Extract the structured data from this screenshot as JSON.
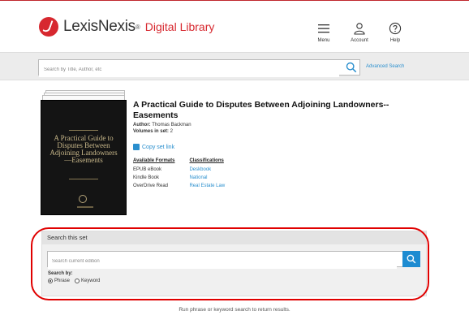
{
  "header": {
    "brand": "LexisNexis",
    "brand_mark": "®",
    "product": "Digital Library",
    "nav": [
      {
        "label": "Menu",
        "icon": "menu-icon"
      },
      {
        "label": "Account",
        "icon": "account-icon"
      },
      {
        "label": "Help",
        "icon": "help-icon"
      }
    ]
  },
  "search": {
    "placeholder": "Search by Title, Author, etc",
    "advanced_label": "Advanced Search"
  },
  "book": {
    "title": "A Practical Guide to Disputes Between Adjoining Landowners--Easements",
    "author_label": "Author:",
    "author": "Thomas Backman",
    "volumes_label": "Volumes in set:",
    "volumes": "2",
    "copy_link": "Copy set link",
    "cover_title": "A Practical Guide to Disputes Between Adjoining Landowners —Easements",
    "formats_header": "Available Formats",
    "formats": [
      "EPUB eBook",
      "Kindle Book",
      "OverDrive Read"
    ],
    "classifications_header": "Classifications",
    "classifications": [
      "Deskbook",
      "National",
      "Real Estate Law"
    ]
  },
  "set_search": {
    "heading": "Search this set",
    "placeholder": "Search current edition",
    "search_by_label": "Search by:",
    "options": [
      "Phrase",
      "Keyword"
    ],
    "selected": "Phrase",
    "hint": "Run phrase or keyword search to return results."
  },
  "colors": {
    "brand_red": "#d7282f",
    "link_blue": "#2a8fce",
    "button_blue": "#1d8bd1",
    "annotation_red": "#e00000"
  }
}
